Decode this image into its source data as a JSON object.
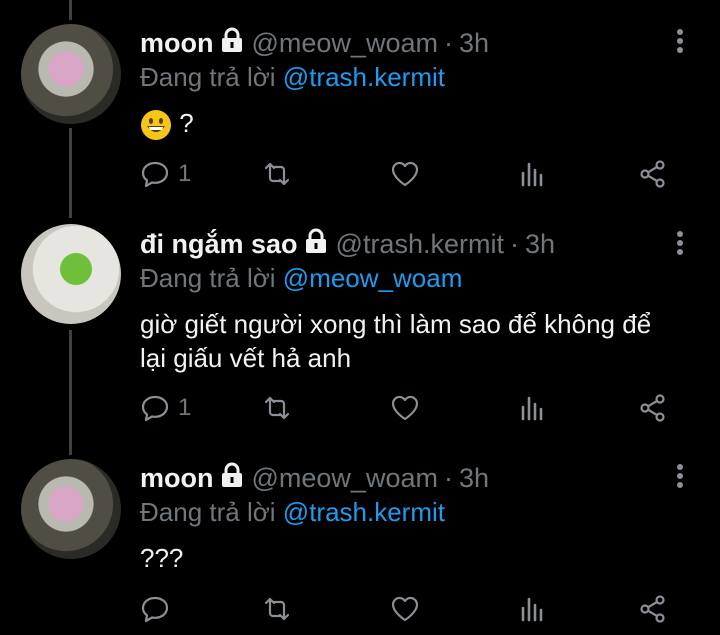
{
  "tweets": [
    {
      "name": "moon",
      "handle": "@meow_woam",
      "separator": "·",
      "time": "3h",
      "reply_prefix": "Đang trả lời",
      "reply_to": "@trash.kermit",
      "text": "?",
      "emoji": "grinning-face-emoji",
      "actions": {
        "reply_count": "1",
        "retweet_count": "",
        "like_count": ""
      }
    },
    {
      "name": "đi ngắm sao",
      "handle": "@trash.kermit",
      "separator": "·",
      "time": "3h",
      "reply_prefix": "Đang trả lời",
      "reply_to": "@meow_woam",
      "text": "giờ giết người xong thì làm sao để không để lại giấu vết hả anh",
      "actions": {
        "reply_count": "1",
        "retweet_count": "",
        "like_count": ""
      }
    },
    {
      "name": "moon",
      "handle": "@meow_woam",
      "separator": "·",
      "time": "3h",
      "reply_prefix": "Đang trả lời",
      "reply_to": "@trash.kermit",
      "text": "???",
      "actions": {
        "reply_count": "",
        "retweet_count": "",
        "like_count": ""
      }
    }
  ],
  "icons": [
    "lock-icon",
    "more-options-icon",
    "reply-icon",
    "retweet-icon",
    "like-icon",
    "analytics-icon",
    "share-icon"
  ],
  "colors": {
    "background": "#000000",
    "mention": "#1d9bf0",
    "muted": "#71767b",
    "thread_line": "#3d4146"
  }
}
